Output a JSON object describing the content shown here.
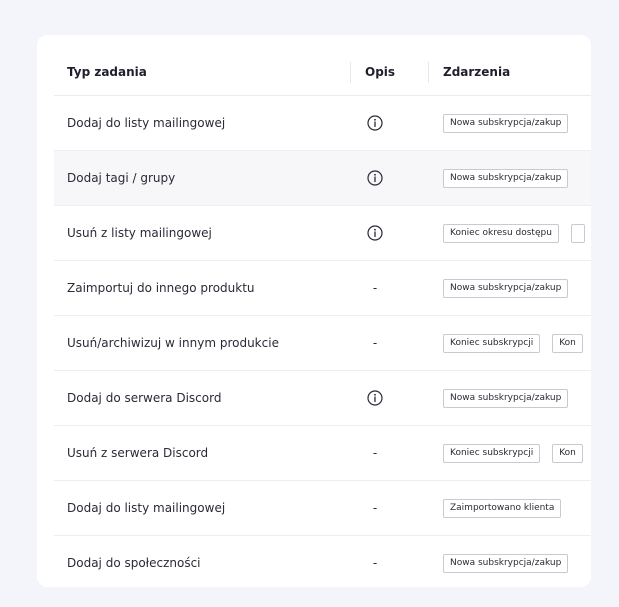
{
  "table": {
    "headers": {
      "type": "Typ zadania",
      "description": "Opis",
      "events": "Zdarzenia"
    },
    "rows": [
      {
        "name": "Dodaj do listy mailingowej",
        "description": "info",
        "events": [
          "Nowa subskrypcja/zakup"
        ]
      },
      {
        "name": "Dodaj tagi / grupy",
        "description": "info",
        "events": [
          "Nowa subskrypcja/zakup"
        ]
      },
      {
        "name": "Usuń z listy mailingowej",
        "description": "info",
        "events": [
          "Koniec okresu dostępu",
          ""
        ]
      },
      {
        "name": "Zaimportuj do innego produktu",
        "description": "-",
        "events": [
          "Nowa subskrypcja/zakup"
        ]
      },
      {
        "name": "Usuń/archiwizuj w innym produkcie",
        "description": "-",
        "events": [
          "Koniec subskrypcji",
          "Kon"
        ]
      },
      {
        "name": "Dodaj do serwera Discord",
        "description": "info",
        "events": [
          "Nowa subskrypcja/zakup"
        ]
      },
      {
        "name": "Usuń z serwera Discord",
        "description": "-",
        "events": [
          "Koniec subskrypcji",
          "Kon"
        ]
      },
      {
        "name": "Dodaj do listy mailingowej",
        "description": "-",
        "events": [
          "Zaimportowano klienta"
        ]
      },
      {
        "name": "Dodaj do społeczności",
        "description": "-",
        "events": [
          "Nowa subskrypcja/zakup"
        ]
      }
    ]
  },
  "icons": {
    "info": "info-circle-icon"
  },
  "colors": {
    "page_background": "#f4f4fb",
    "card_background": "#ffffff",
    "shaded_row": "#f7f7f9",
    "badge_border": "#c9c9d2",
    "text": "#1f1f2b"
  }
}
